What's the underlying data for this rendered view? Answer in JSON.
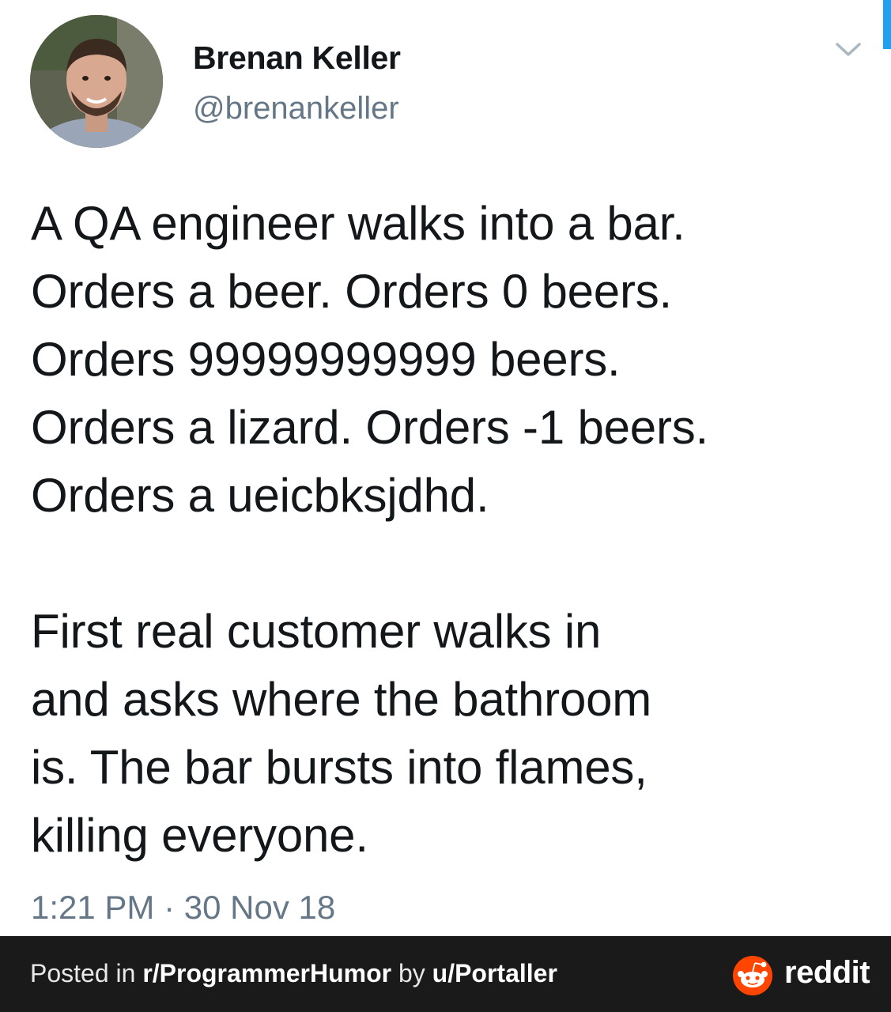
{
  "tweet": {
    "author": {
      "display_name": "Brenan Keller",
      "handle": "@brenankeller",
      "avatar_icon": "profile-photo"
    },
    "menu_icon": "chevron-down-icon",
    "text_lines_1": [
      "A QA engineer walks into a bar.",
      "Orders a beer. Orders 0 beers.",
      "Orders 99999999999 beers.",
      "Orders a lizard. Orders -1 beers.",
      "Orders a ueicbksjdhd."
    ],
    "text_lines_2": [
      "First real customer walks in",
      "and asks where the bathroom",
      "is. The bar bursts into flames,",
      "killing everyone."
    ],
    "time": "1:21 PM",
    "separator": "·",
    "date": "30 Nov 18"
  },
  "footer": {
    "posted_in": "Posted in ",
    "subreddit": "r/ProgrammerHumor",
    "by": " by ",
    "user": "u/Portaller",
    "brand": "reddit",
    "brand_icon": "reddit-snoo-icon"
  },
  "colors": {
    "text": "#14171a",
    "muted": "#657786",
    "accent": "#1da1f2",
    "footer_bg": "#1a1a1b",
    "reddit_orange": "#ff4500"
  }
}
